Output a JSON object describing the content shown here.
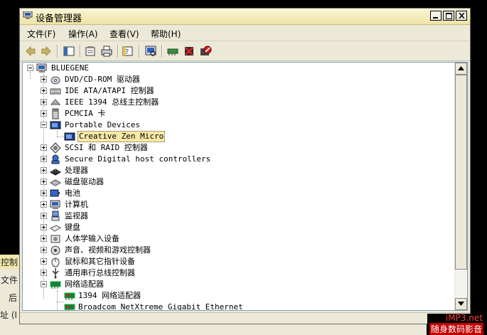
{
  "background_window": {
    "lines": [
      "控制",
      "文件",
      "后",
      "址 (I"
    ]
  },
  "window": {
    "title": "设备管理器",
    "title_icon": "device-manager-icon",
    "buttons": [
      "minimize",
      "maximize",
      "close"
    ]
  },
  "menu": [
    {
      "label": "文件(F)"
    },
    {
      "label": "操作(A)"
    },
    {
      "label": "查看(V)"
    },
    {
      "label": "帮助(H)"
    }
  ],
  "toolbar": [
    {
      "name": "back-icon"
    },
    {
      "name": "forward-icon"
    },
    {
      "name": "show-hide-console-tree-icon"
    },
    {
      "name": "properties-icon"
    },
    {
      "name": "print-icon"
    },
    {
      "name": "help-icon"
    },
    {
      "name": "scan-hardware-changes-icon"
    },
    {
      "name": "update-driver-icon"
    },
    {
      "name": "uninstall-icon"
    },
    {
      "name": "disable-icon"
    }
  ],
  "tree": {
    "root": "BLUEGENE",
    "nodes": [
      {
        "label": "DVD/CD-ROM 驱动器",
        "icon": "dvd-drive-icon",
        "expanded": false,
        "children": []
      },
      {
        "label": "IDE ATA/ATAPI 控制器",
        "icon": "ide-controller-icon",
        "expanded": false,
        "children": []
      },
      {
        "label": "IEEE 1394 总线主控制器",
        "icon": "ieee1394-icon",
        "expanded": false,
        "children": []
      },
      {
        "label": "PCMCIA 卡",
        "icon": "pcmcia-icon",
        "expanded": false,
        "children": []
      },
      {
        "label": "Portable Devices",
        "icon": "portable-devices-icon",
        "expanded": true,
        "children": [
          {
            "label": "Creative Zen Micro",
            "icon": "media-player-icon",
            "selected": true
          }
        ]
      },
      {
        "label": "SCSI 和 RAID 控制器",
        "icon": "scsi-icon",
        "expanded": false,
        "children": []
      },
      {
        "label": "Secure Digital host controllers",
        "icon": "sd-controller-icon",
        "expanded": false,
        "children": []
      },
      {
        "label": "处理器",
        "icon": "processor-icon",
        "expanded": false,
        "children": []
      },
      {
        "label": "磁盘驱动器",
        "icon": "disk-drive-icon",
        "expanded": false,
        "children": []
      },
      {
        "label": "电池",
        "icon": "battery-icon",
        "expanded": false,
        "children": []
      },
      {
        "label": "计算机",
        "icon": "computer-icon",
        "expanded": false,
        "children": []
      },
      {
        "label": "监视器",
        "icon": "monitor-icon",
        "expanded": false,
        "children": []
      },
      {
        "label": "键盘",
        "icon": "keyboard-icon",
        "expanded": false,
        "children": []
      },
      {
        "label": "人体学输入设备",
        "icon": "hid-icon",
        "expanded": false,
        "children": []
      },
      {
        "label": "声音、视频和游戏控制器",
        "icon": "sound-icon",
        "expanded": false,
        "children": []
      },
      {
        "label": "鼠标和其它指针设备",
        "icon": "mouse-icon",
        "expanded": false,
        "children": []
      },
      {
        "label": "通用串行总线控制器",
        "icon": "usb-icon",
        "expanded": false,
        "children": []
      },
      {
        "label": "网络适配器",
        "icon": "network-adapter-icon",
        "expanded": true,
        "children": [
          {
            "label": "1394 网络适配器",
            "icon": "network-card-icon"
          },
          {
            "label": "Broadcom NetXtreme Gigabit Ethernet",
            "icon": "network-card-icon"
          }
        ]
      }
    ]
  },
  "watermark": {
    "line1": "iMP3.net",
    "line2": "随身数码影音"
  }
}
